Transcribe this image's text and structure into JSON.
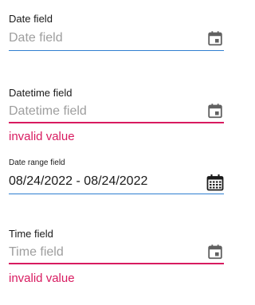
{
  "colors": {
    "accent": "#2f7fd1",
    "error": "#d81b60"
  },
  "fields": [
    {
      "label": "Date field",
      "placeholder": "Date field",
      "icon": "calendar-icon"
    },
    {
      "label": "Datetime field",
      "placeholder": "Datetime field",
      "icon": "calendar-icon",
      "error": "invalid value"
    },
    {
      "label": "Date range field",
      "value": "08/24/2022 - 08/24/2022",
      "icon": "calendar-range-icon"
    },
    {
      "label": "Time field",
      "placeholder": "Time field",
      "icon": "calendar-icon",
      "error": "invalid value"
    }
  ]
}
